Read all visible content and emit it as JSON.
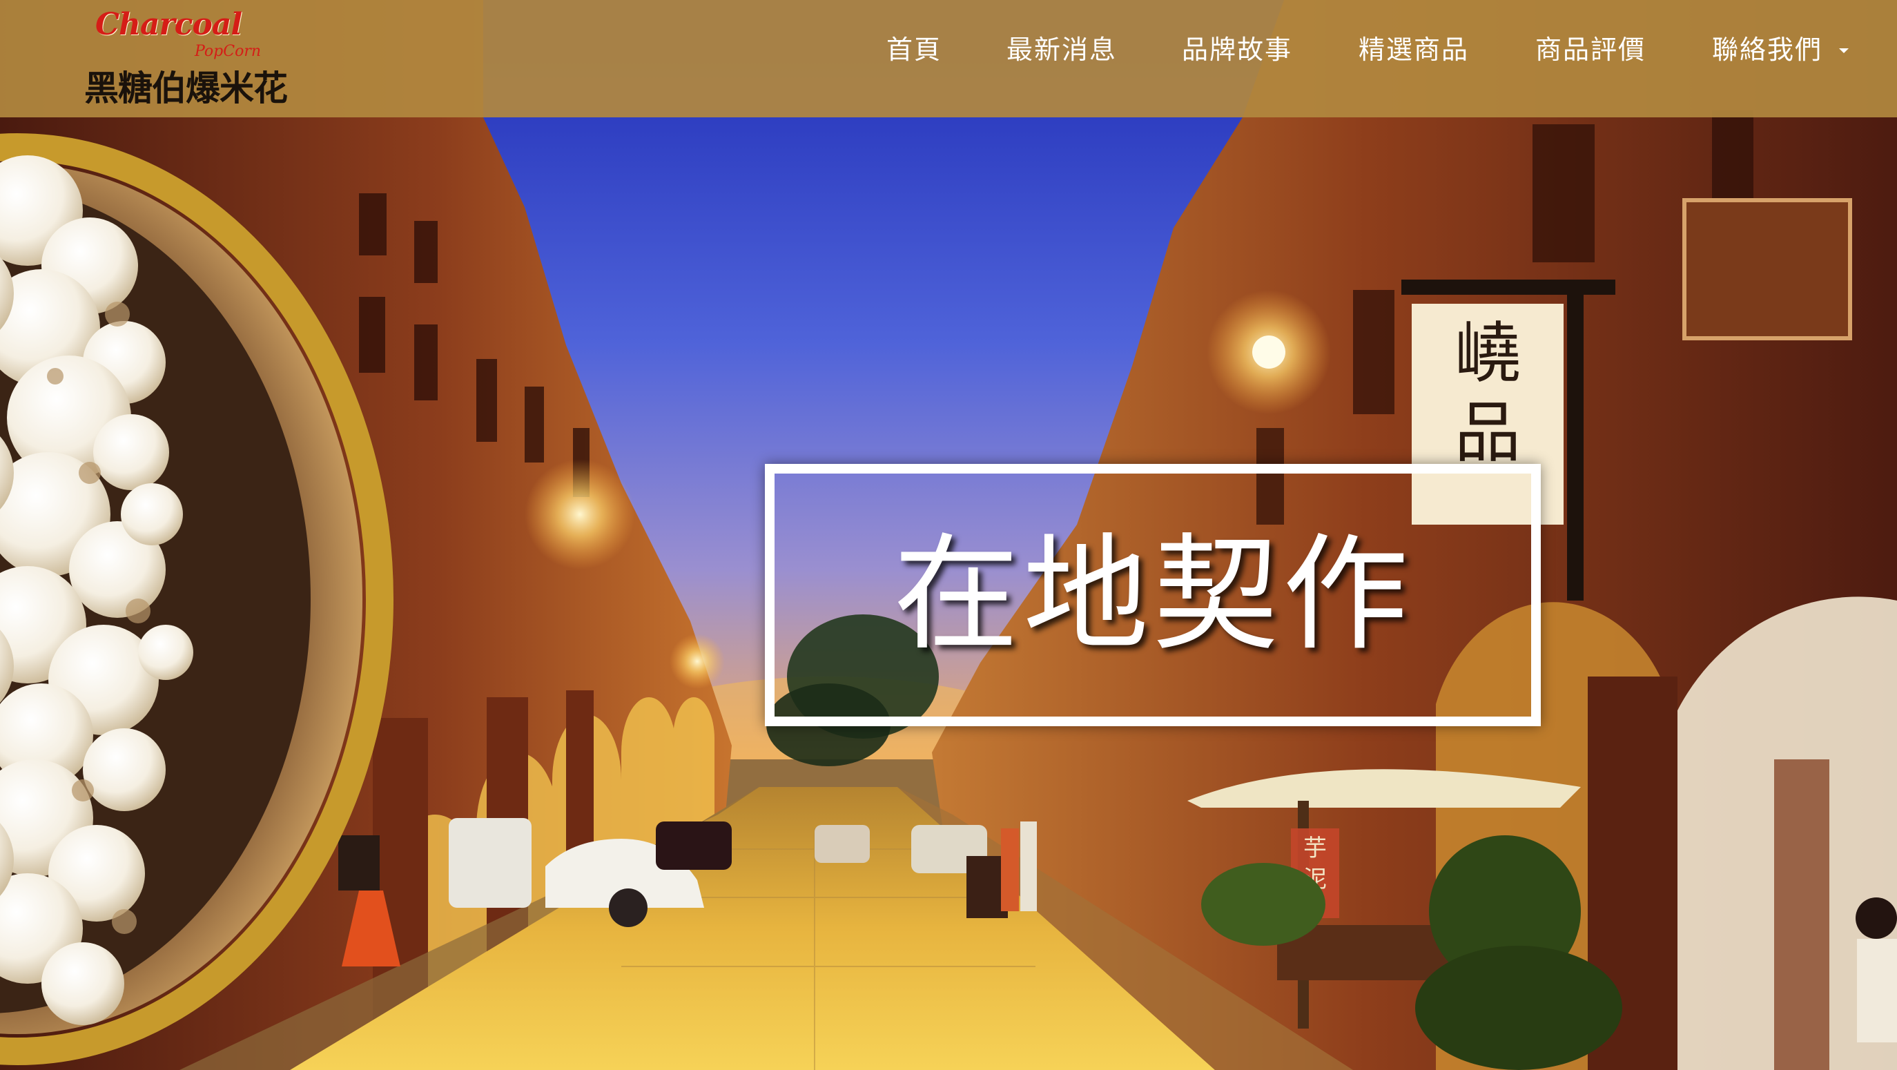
{
  "header": {
    "logo": {
      "en": "Charcoal",
      "sub": "PopCorn",
      "cn": "黑糖伯爆米花"
    },
    "nav": [
      {
        "label": "首頁"
      },
      {
        "label": "最新消息"
      },
      {
        "label": "品牌故事"
      },
      {
        "label": "精選商品"
      },
      {
        "label": "商品評價"
      },
      {
        "label": "聯絡我們"
      }
    ],
    "colors": {
      "bar": "#b2883e",
      "logo_red": "#d51d17",
      "text": "#ffffff"
    }
  },
  "hero": {
    "title": "在地契作",
    "sign_text": "嶢品",
    "stall_sign": "芋泥"
  }
}
